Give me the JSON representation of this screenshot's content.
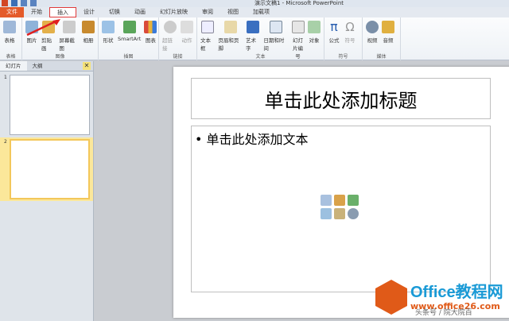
{
  "window": {
    "title": "演示文稿1 - Microsoft PowerPoint"
  },
  "tabs": [
    "文件",
    "开始",
    "插入",
    "设计",
    "切换",
    "动画",
    "幻灯片放映",
    "审阅",
    "视图",
    "加载项"
  ],
  "ribbon": {
    "groups": [
      {
        "label": "表格",
        "buttons": [
          "表格"
        ]
      },
      {
        "label": "图像",
        "buttons": [
          "图片",
          "剪贴画",
          "屏幕截图",
          "相册"
        ]
      },
      {
        "label": "插图",
        "buttons": [
          "形状",
          "SmartArt",
          "图表"
        ]
      },
      {
        "label": "链接",
        "buttons": [
          "超链接",
          "动作"
        ]
      },
      {
        "label": "文本",
        "buttons": [
          "文本框",
          "页眉和页脚",
          "艺术字",
          "日期和时间",
          "幻灯片编号",
          "对象"
        ]
      },
      {
        "label": "符号",
        "buttons": [
          "公式",
          "符号"
        ]
      },
      {
        "label": "媒体",
        "buttons": [
          "视频",
          "音频"
        ]
      }
    ]
  },
  "panel": {
    "tabs": [
      "幻灯片",
      "大纲"
    ],
    "close": "✕",
    "slides": [
      "1",
      "2"
    ]
  },
  "slide": {
    "title_placeholder": "单击此处添加标题",
    "body_placeholder": "单击此处添加文本",
    "bullet": "•"
  },
  "watermark": {
    "brand": "Office教程网",
    "url": "www.office26.com",
    "source": "头条号 / 院大院百"
  },
  "colors": {
    "file_tab": "#e45b2a",
    "accent": "#e03a3a",
    "selected_slide": "#fbe79a"
  }
}
